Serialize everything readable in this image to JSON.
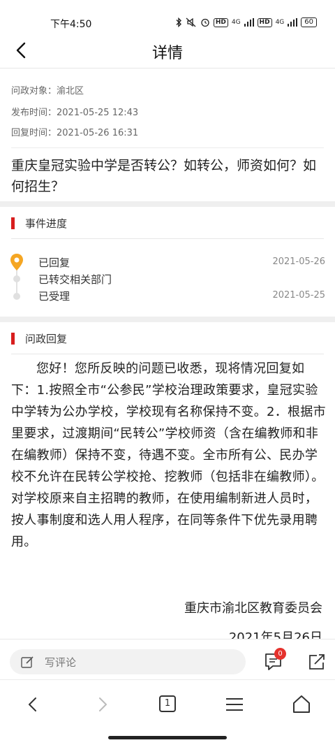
{
  "status_bar": {
    "time": "下午4:50",
    "hd1": "HD",
    "net1": "4G",
    "hd2": "HD",
    "net2": "4G",
    "battery": "60"
  },
  "nav": {
    "back_icon": "chevron-left-icon",
    "title": "详情"
  },
  "meta": {
    "target_label": "问政对象：",
    "target_value": "渝北区",
    "published_label": "发布时间：",
    "published_value": "2021-05-25 12:43",
    "replied_label": "回复时间：",
    "replied_value": "2021-05-26 16:31"
  },
  "question": "重庆皇冠实验中学是否转公？如转公，师资如何？如何招生？",
  "progress": {
    "section_title": "事件进度",
    "steps": [
      {
        "label": "已回复",
        "date": "2021-05-26",
        "active": true
      },
      {
        "label": "已转交相关部门",
        "date": ""
      },
      {
        "label": "已受理",
        "date": "2021-05-25"
      }
    ]
  },
  "reply": {
    "section_title": "问政回复",
    "body": "您好！您所反映的问题已收悉，现将情况回复如下：1.按照全市“公参民”学校治理政策要求，皇冠实验中学转为公办学校，学校现有名称保持不变。2．根据市里要求，过渡期间“民转公”学校师资（含在编教师和非在编教师）保持不变，待遇不变。全市所有公、民办学校不允许在民转公学校抢、挖教师（包括非在编教师）。对学校原来自主招聘的教师，在使用编制新进人员时，按人事制度和选人用人程序，在同等条件下优先录用聘用。",
    "signature": "重庆市渝北区教育委员会",
    "date": "2021年5月26日"
  },
  "comment_bar": {
    "placeholder": "写评论",
    "badge_count": "0",
    "icons": [
      "edit-icon",
      "message-icon",
      "share-icon"
    ]
  },
  "browser_bar": {
    "tab_count": "1",
    "icons": [
      "back-icon",
      "forward-icon",
      "tabs-icon",
      "menu-icon",
      "home-icon"
    ]
  },
  "colors": {
    "accent_red": "#d81e1e",
    "pin_orange": "#f5a623",
    "badge_red": "#e5322d"
  }
}
